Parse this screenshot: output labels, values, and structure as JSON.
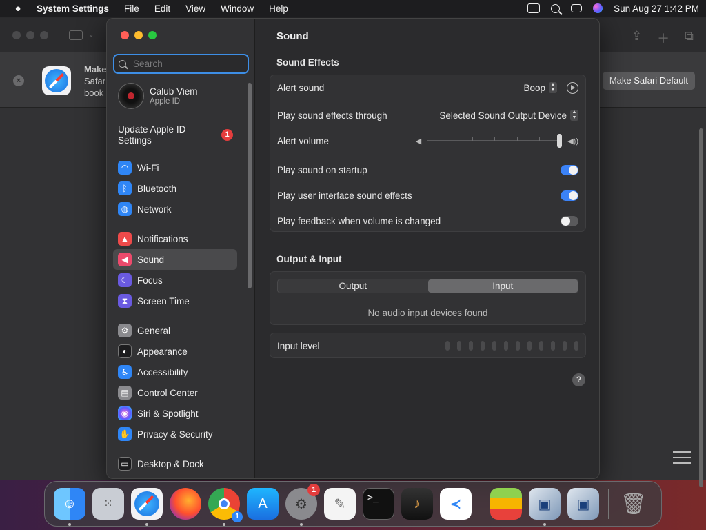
{
  "menubar": {
    "app_name": "System Settings",
    "menus": [
      "File",
      "Edit",
      "View",
      "Window",
      "Help"
    ],
    "datetime": "Sun Aug 27  1:42 PM"
  },
  "safari": {
    "banner_title": "Make",
    "banner_line2": "Safar",
    "banner_line3": "book",
    "make_default_label": "Make Safari Default"
  },
  "sidebar": {
    "search_placeholder": "Search",
    "profile_name": "Calub Viem",
    "profile_sub": "Apple ID",
    "update_label": "Update Apple ID Settings",
    "update_badge": "1",
    "items": [
      {
        "label": "Wi-Fi",
        "icon": "wifi-icon",
        "color": "#2f86f6",
        "glyph": "◠"
      },
      {
        "label": "Bluetooth",
        "icon": "bluetooth-icon",
        "color": "#2f86f6",
        "glyph": "ᛒ"
      },
      {
        "label": "Network",
        "icon": "globe-icon",
        "color": "#2f86f6",
        "glyph": "◍"
      },
      {
        "label": "Notifications",
        "icon": "bell-icon",
        "color": "#ee4a4a",
        "glyph": "▲"
      },
      {
        "label": "Sound",
        "icon": "speaker-icon",
        "color": "#ec4a6c",
        "glyph": "◀"
      },
      {
        "label": "Focus",
        "icon": "moon-icon",
        "color": "#6a5ae0",
        "glyph": "☾"
      },
      {
        "label": "Screen Time",
        "icon": "hourglass-icon",
        "color": "#6a5ae0",
        "glyph": "⧗"
      },
      {
        "label": "General",
        "icon": "gear-icon",
        "color": "#8a8a8e",
        "glyph": "⚙"
      },
      {
        "label": "Appearance",
        "icon": "appearance-icon",
        "color": "#1c1c1e",
        "glyph": "◐"
      },
      {
        "label": "Accessibility",
        "icon": "accessibility-icon",
        "color": "#2f86f6",
        "glyph": "♿"
      },
      {
        "label": "Control Center",
        "icon": "control-center-icon",
        "color": "#8a8a8e",
        "glyph": "▤"
      },
      {
        "label": "Siri & Spotlight",
        "icon": "siri-icon",
        "color": "#a24cd6",
        "glyph": "◉"
      },
      {
        "label": "Privacy & Security",
        "icon": "hand-icon",
        "color": "#2f86f6",
        "glyph": "✋"
      },
      {
        "label": "Desktop & Dock",
        "icon": "dock-icon",
        "color": "#1c1c1e",
        "glyph": "▭"
      }
    ]
  },
  "content": {
    "title": "Sound",
    "sound_effects_title": "Sound Effects",
    "alert_sound_label": "Alert sound",
    "alert_sound_value": "Boop",
    "play_through_label": "Play sound effects through",
    "play_through_value": "Selected Sound Output Device",
    "alert_volume_label": "Alert volume",
    "alert_volume_level": 1.0,
    "startup_label": "Play sound on startup",
    "startup_on": true,
    "ui_effects_label": "Play user interface sound effects",
    "ui_effects_on": true,
    "feedback_label": "Play feedback when volume is changed",
    "feedback_on": false,
    "output_input_title": "Output & Input",
    "tab_output": "Output",
    "tab_input": "Input",
    "selected_tab": "Input",
    "no_devices": "No audio input devices found",
    "input_level_label": "Input level",
    "help_label": "?"
  },
  "dock": {
    "settings_badge": "1",
    "chrome_badge": "1"
  }
}
